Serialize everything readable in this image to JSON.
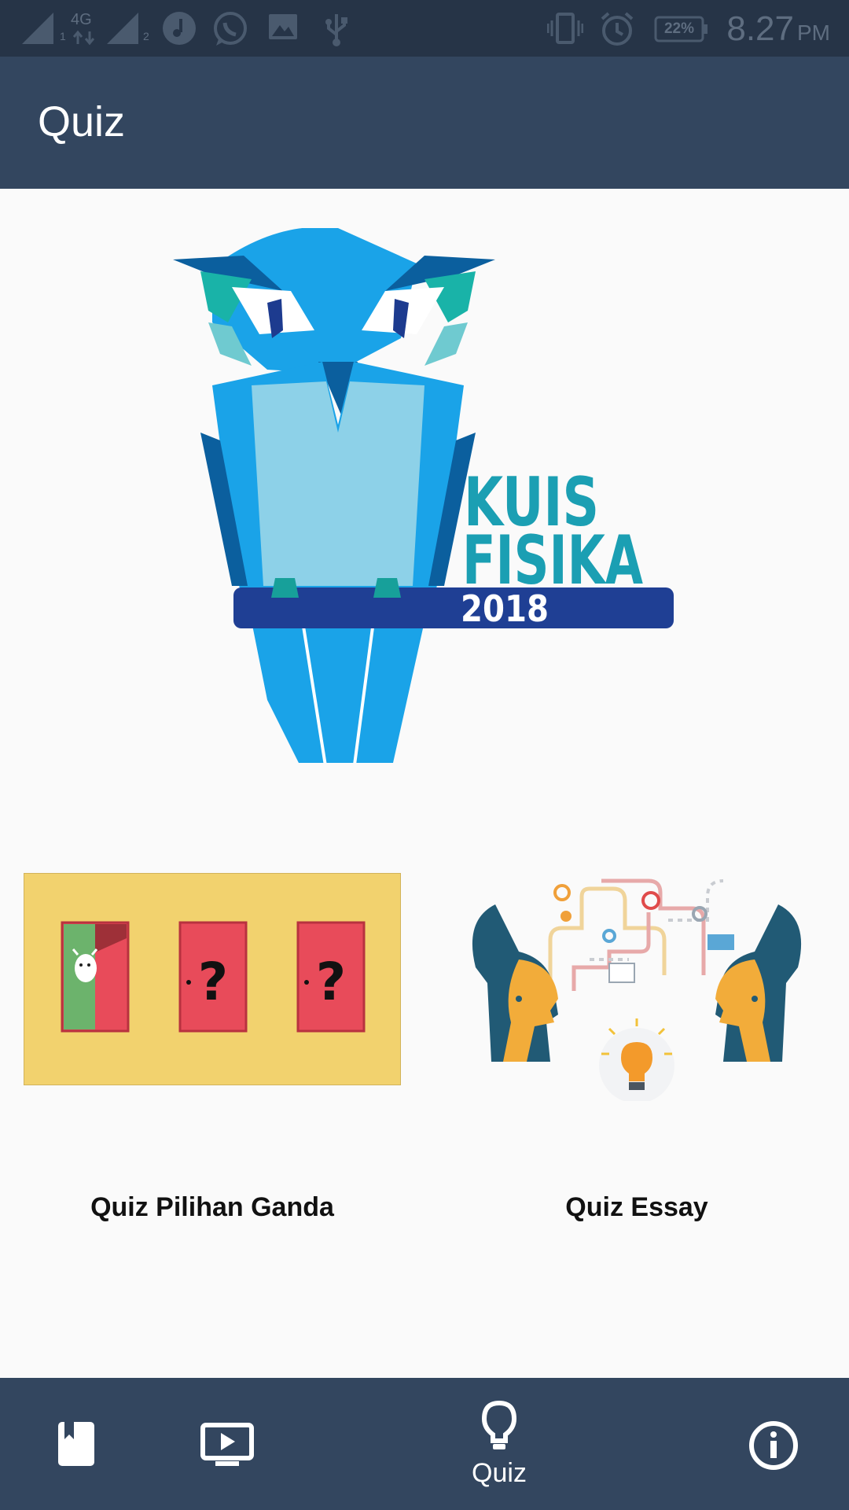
{
  "status_bar": {
    "network": "4G",
    "sim1": "1",
    "sim2": "2",
    "battery": "22%",
    "time": "8.27",
    "ampm": "PM"
  },
  "app_bar": {
    "title": "Quiz"
  },
  "logo": {
    "line1": "KUIS",
    "line2": "FISIKA",
    "year": "2018"
  },
  "cards": [
    {
      "label": "Quiz Pilihan Ganda",
      "image_icon": "doors-icon"
    },
    {
      "label": "Quiz Essay",
      "image_icon": "thinking-heads-icon"
    }
  ],
  "bottom_nav": {
    "items": [
      {
        "icon": "book-icon",
        "label": ""
      },
      {
        "icon": "video-icon",
        "label": ""
      },
      {
        "icon": "lightbulb-icon",
        "label": "Quiz",
        "active": true
      },
      {
        "icon": "info-icon",
        "label": ""
      }
    ]
  },
  "colors": {
    "status_bar": "#263447",
    "app_bar": "#33465f",
    "bottom_nav": "#33465f",
    "background": "#fafafa",
    "owl_blue": "#1aa3e8",
    "logo_teal": "#1b9fb3",
    "perch": "#1f3f94",
    "card_yellow": "#f2d26e",
    "door_red": "#e84b5a"
  }
}
